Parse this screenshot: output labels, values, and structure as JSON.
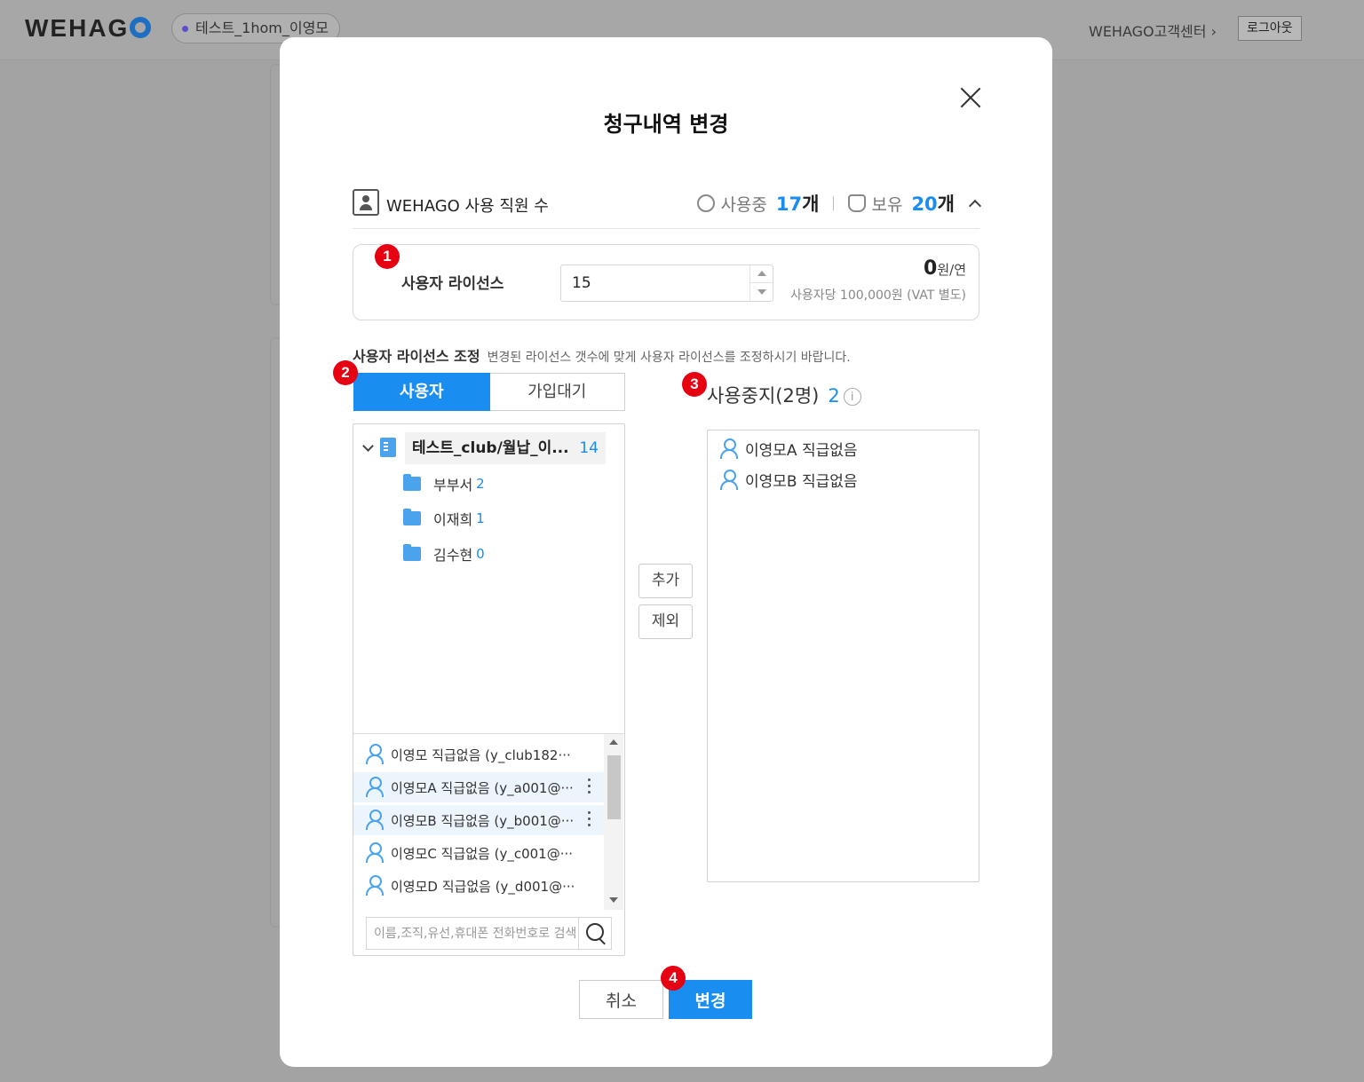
{
  "app": {
    "logo_text": "WEHAG",
    "company": "테스트_1hom_이영모",
    "customer_center": "WEHAGO고객센터 ›",
    "logout": "로그아웃"
  },
  "modal": {
    "title": "청구내역 변경",
    "staff": {
      "label": "WEHAGO 사용 직원 수",
      "in_use_label": "사용중",
      "in_use_count": "17",
      "owned_label": "보유",
      "owned_count": "20",
      "unit": "개"
    },
    "license": {
      "label": "사용자 라이선스",
      "value": "15",
      "price": "0",
      "price_unit": "원/연",
      "price_note": "사용자당 100,000원 (VAT 별도)"
    },
    "adjust": {
      "title": "사용자 라이선스 조정",
      "desc": "변경된 라이선스 갯수에 맞게 사용자 라이선스를 조정하시기 바랍니다."
    },
    "tabs": [
      {
        "label": "사용자"
      },
      {
        "label": "가입대기"
      }
    ],
    "tree": {
      "root_name": "테스트_club/월납_이...",
      "root_count": "14",
      "depts": [
        {
          "name": "부부서",
          "count": "2"
        },
        {
          "name": "이재희",
          "count": "1"
        },
        {
          "name": "김수현",
          "count": "0"
        }
      ]
    },
    "users": [
      {
        "text": "이영모 직급없음 (y_club182···"
      },
      {
        "text": "이영모A 직급없음 (y_a001@···"
      },
      {
        "text": "이영모B 직급없음 (y_b001@···"
      },
      {
        "text": "이영모C 직급없음 (y_c001@···"
      },
      {
        "text": "이영모D 직급없음 (y_d001@···"
      }
    ],
    "search_placeholder": "이름,조직,유선,휴대폰 전화번호로 검색",
    "add_label": "추가",
    "remove_label": "제외",
    "suspended": {
      "title": "사용중지(2명)",
      "count": "2",
      "info": "i",
      "users": [
        {
          "text": "이영모A 직급없음"
        },
        {
          "text": "이영모B 직급없음"
        }
      ]
    },
    "cancel_label": "취소",
    "change_label": "변경"
  },
  "badges": [
    "1",
    "2",
    "3",
    "4"
  ],
  "colors": {
    "accent": "#1a8df0",
    "badge": "#e60012"
  }
}
